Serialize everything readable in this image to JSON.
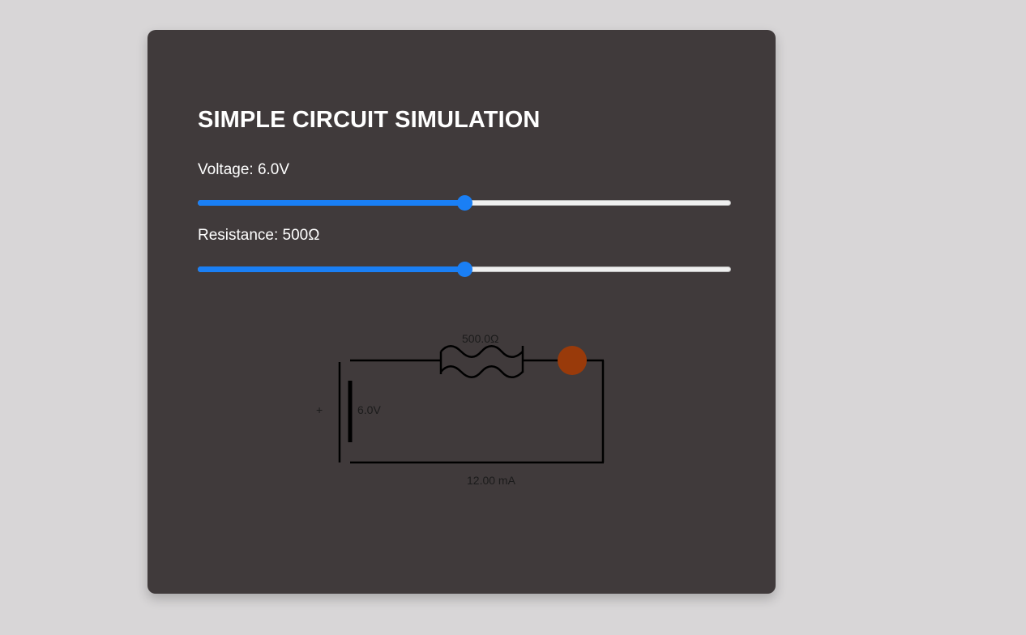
{
  "title": "SIMPLE CIRCUIT SIMULATION",
  "voltage": {
    "label": "Voltage: 6.0V",
    "fraction": 0.5
  },
  "resistance": {
    "label": "Resistance: 500Ω",
    "fraction": 0.5
  },
  "circuit": {
    "resistor_label": "500.0Ω",
    "battery_plus": "+",
    "battery_label": "6.0V",
    "current_label": "12.00 mA",
    "bulb_color": "#993a0a"
  },
  "colors": {
    "accent": "#1a7ff5",
    "card": "#403a3b",
    "background": "#d8d6d7"
  }
}
